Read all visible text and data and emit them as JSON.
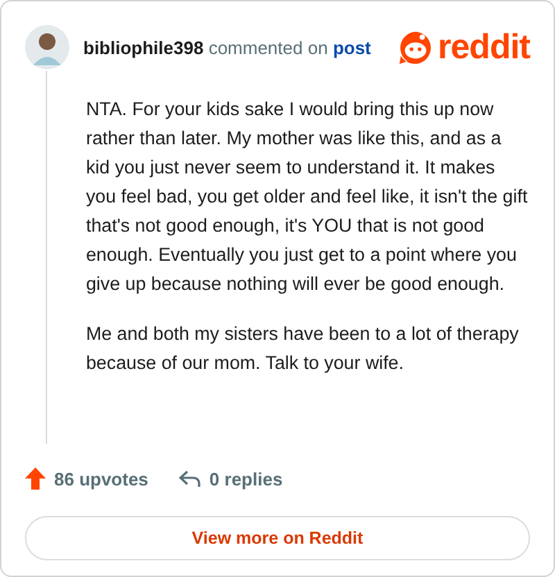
{
  "comment": {
    "author": "bibliophile398",
    "action": "commented on",
    "target": "post",
    "paragraphs": [
      "NTA. For your kids sake I would bring this up now rather than later. My mother was like this, and as a kid you just never seem to understand it. It makes you feel bad, you get older and feel like, it isn't the gift that's not good enough, it's YOU that is not good enough. Eventually you just get to a point where you give up because nothing will ever be good enough.",
      "Me and both my sisters have been to a lot of therapy because of our mom. Talk to your wife."
    ],
    "upvotes": "86 upvotes",
    "replies": "0 replies"
  },
  "logo": {
    "text": "reddit"
  },
  "button": "View more on Reddit"
}
